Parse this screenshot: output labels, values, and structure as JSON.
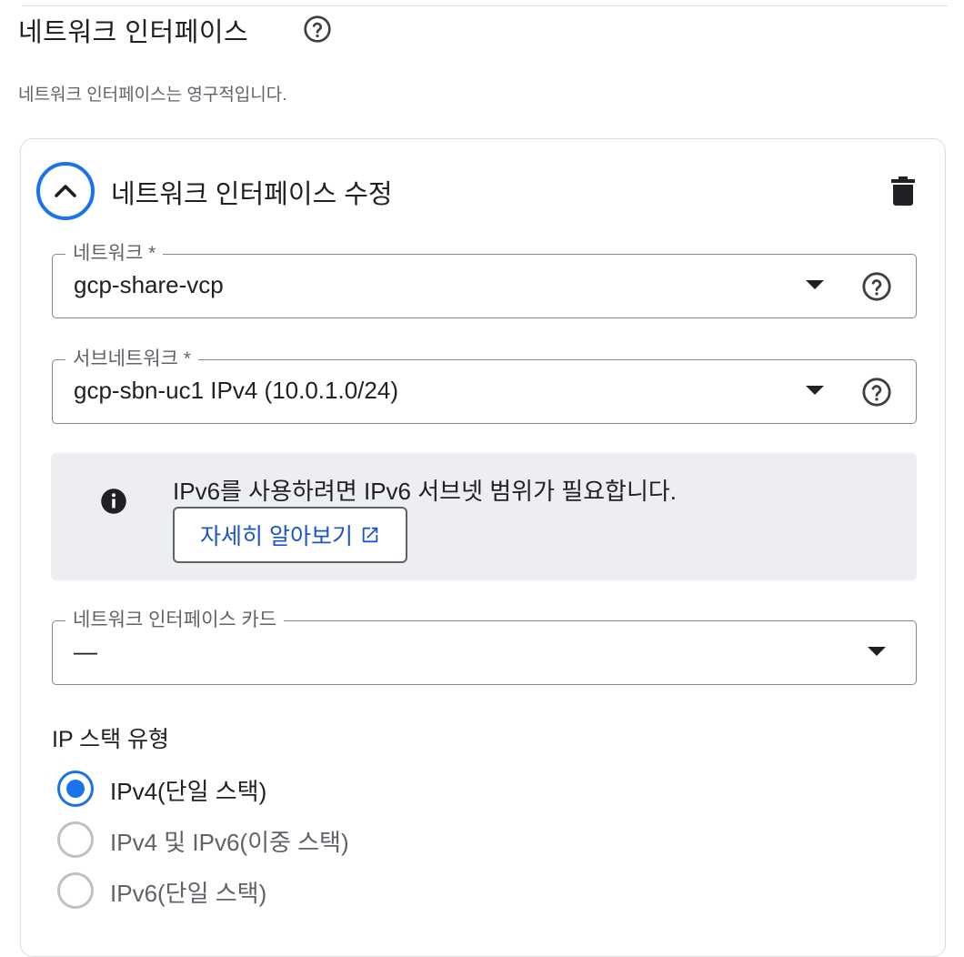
{
  "section": {
    "title": "네트워크 인터페이스",
    "description": "네트워크 인터페이스는 영구적입니다."
  },
  "card": {
    "title": "네트워크 인터페이스 수정"
  },
  "fields": {
    "network": {
      "label": "네트워크 *",
      "value": "gcp-share-vcp"
    },
    "subnetwork": {
      "label": "서브네트워크 *",
      "value": "gcp-sbn-uc1 IPv4 (10.0.1.0/24)"
    },
    "nic": {
      "label": "네트워크 인터페이스 카드",
      "value": "—"
    }
  },
  "info": {
    "text": "IPv6를 사용하려면 IPv6 서브넷 범위가 필요합니다.",
    "button_label": "자세히 알아보기"
  },
  "ip_stack": {
    "label": "IP 스택 유형",
    "options": [
      {
        "label": "IPv4(단일 스택)",
        "selected": true
      },
      {
        "label": "IPv4 및 IPv6(이중 스택)",
        "selected": false
      },
      {
        "label": "IPv6(단일 스택)",
        "selected": false
      }
    ]
  },
  "colors": {
    "accent": "#1a73e8",
    "link": "#1a56c7",
    "info_bg": "#eceef2",
    "border": "#80868b",
    "disabled_text": "#5f6368"
  },
  "icons": [
    "help-circle-icon",
    "chevron-up-icon",
    "trash-icon",
    "dropdown-arrow-icon",
    "info-icon",
    "open-in-new-icon"
  ]
}
